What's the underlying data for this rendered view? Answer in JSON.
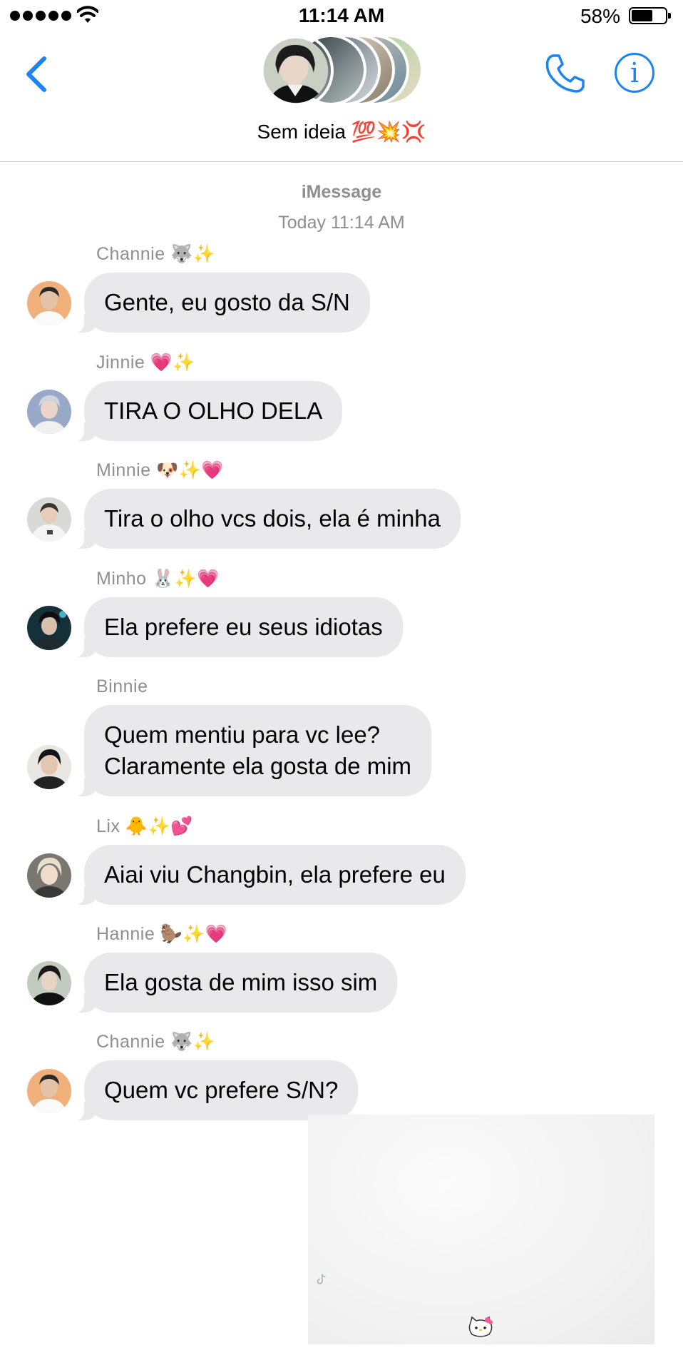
{
  "status_bar": {
    "time": "11:14 AM",
    "battery": "58%"
  },
  "header": {
    "group_name": "Sem ideia 💯💥💢"
  },
  "thread": {
    "service": "iMessage",
    "timestamp": "Today 11:14 AM",
    "messages": [
      {
        "sender": "Channie 🐺✨",
        "text": "Gente, eu gosto da S/N"
      },
      {
        "sender": "Jinnie 💗✨",
        "text": "TIRA O OLHO DELA"
      },
      {
        "sender": "Minnie 🐶✨💗",
        "text": "Tira o olho vcs dois, ela é minha"
      },
      {
        "sender": "Minho 🐰✨💗",
        "text": "Ela prefere eu seus idiotas"
      },
      {
        "sender": "Binnie",
        "text_line1": "Quem mentiu para vc lee?",
        "text_line2": "Claramente ela gosta de mim"
      },
      {
        "sender": "Lix 🐥✨💕",
        "text": "Aiai viu Changbin, ela prefere eu"
      },
      {
        "sender": "Hannie 🦫✨💗",
        "text": "Ela gosta de mim isso sim"
      },
      {
        "sender": "Channie 🐺✨",
        "text": "Quem vc prefere S/N?"
      }
    ]
  },
  "colors": {
    "accent": "#1b84f0",
    "bubble": "#e9e9eb",
    "meta_text": "#8e8e93"
  },
  "icons": [
    "back-chevron-icon",
    "phone-icon",
    "info-icon",
    "wifi-icon",
    "tiktok-icon",
    "hello-kitty-icon"
  ]
}
